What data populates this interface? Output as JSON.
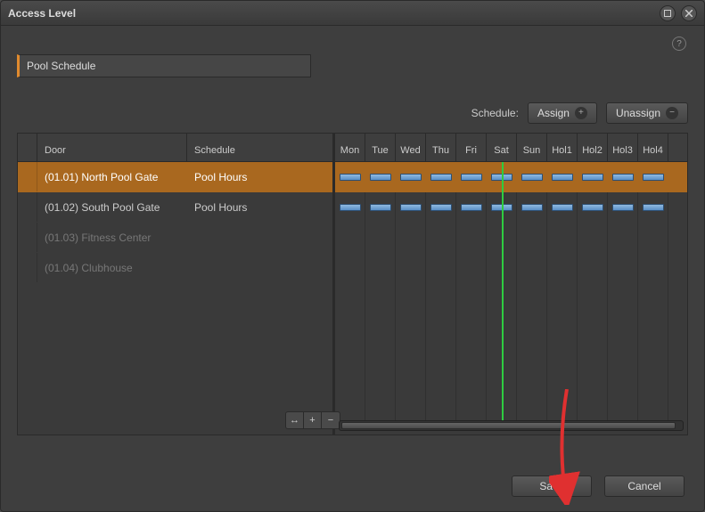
{
  "window": {
    "title": "Access Level"
  },
  "name_field": {
    "value": "Pool Schedule"
  },
  "schedule_bar": {
    "label": "Schedule:",
    "assign": "Assign",
    "unassign": "Unassign"
  },
  "columns": {
    "door": "Door",
    "schedule": "Schedule",
    "days": [
      "Mon",
      "Tue",
      "Wed",
      "Thu",
      "Fri",
      "Sat",
      "Sun",
      "Hol1",
      "Hol2",
      "Hol3",
      "Hol4"
    ]
  },
  "rows": [
    {
      "door": "(01.01) North Pool Gate",
      "schedule": "Pool Hours",
      "selected": true,
      "assigned": true
    },
    {
      "door": "(01.02) South Pool Gate",
      "schedule": "Pool Hours",
      "selected": false,
      "assigned": true
    },
    {
      "door": "(01.03) Fitness Center",
      "schedule": "",
      "selected": false,
      "assigned": false
    },
    {
      "door": "(01.04) Clubhouse",
      "schedule": "",
      "selected": false,
      "assigned": false
    }
  ],
  "footer": {
    "save": "Save",
    "cancel": "Cancel"
  }
}
